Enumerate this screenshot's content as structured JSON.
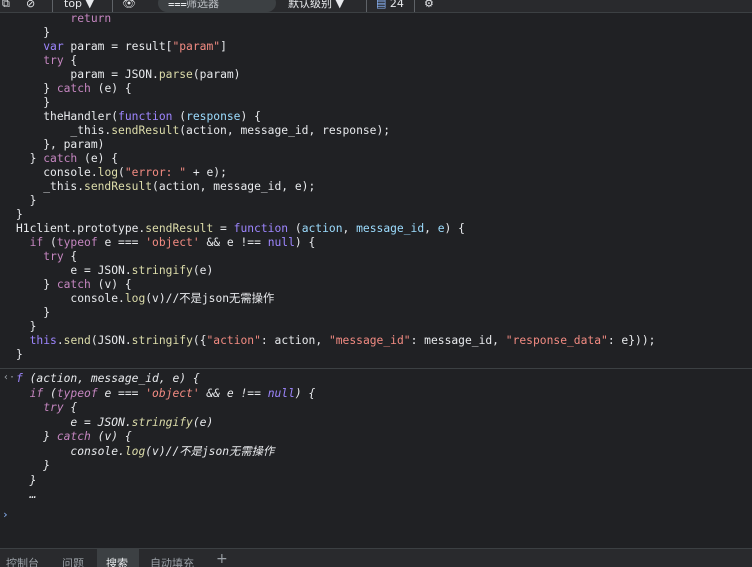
{
  "toolbar": {
    "context_label": "top",
    "filter_placeholder": "筛选器",
    "level_label": "默认级别",
    "issue_count": "24"
  },
  "code_lines": [
    [
      [
        "pad",
        "        "
      ],
      [
        "kw",
        "return"
      ]
    ],
    [
      [
        "pad",
        "    "
      ],
      [
        "prop",
        "}"
      ]
    ],
    [
      [
        "pad",
        "    "
      ],
      [
        "kw2",
        "var"
      ],
      [
        "prop",
        " param = result["
      ],
      [
        "str",
        "\"param\""
      ],
      [
        "prop",
        "]"
      ]
    ],
    [
      [
        "pad",
        "    "
      ],
      [
        "kw",
        "try"
      ],
      [
        "prop",
        " {"
      ]
    ],
    [
      [
        "pad",
        "        "
      ],
      [
        "prop",
        "param = JSON."
      ],
      [
        "fn",
        "parse"
      ],
      [
        "prop",
        "(param)"
      ]
    ],
    [
      [
        "pad",
        "    "
      ],
      [
        "prop",
        "} "
      ],
      [
        "kw",
        "catch"
      ],
      [
        "prop",
        " (e) {"
      ]
    ],
    [
      [
        "pad",
        "    "
      ],
      [
        "prop",
        "}"
      ]
    ],
    [
      [
        "pad",
        "    "
      ],
      [
        "prop",
        "theHandler("
      ],
      [
        "kw2",
        "function"
      ],
      [
        "prop",
        " ("
      ],
      [
        "num",
        "response"
      ],
      [
        "prop",
        ") {"
      ]
    ],
    [
      [
        "pad",
        "        "
      ],
      [
        "prop",
        "_this."
      ],
      [
        "fn",
        "sendResult"
      ],
      [
        "prop",
        "(action, message_id, response);"
      ]
    ],
    [
      [
        "pad",
        "    "
      ],
      [
        "prop",
        "}, param)"
      ]
    ],
    [
      [
        "pad",
        "  "
      ],
      [
        "prop",
        "} "
      ],
      [
        "kw",
        "catch"
      ],
      [
        "prop",
        " (e) {"
      ]
    ],
    [
      [
        "pad",
        "    "
      ],
      [
        "prop",
        "console."
      ],
      [
        "fn",
        "log"
      ],
      [
        "prop",
        "("
      ],
      [
        "str",
        "\"error: \""
      ],
      [
        "prop",
        " + e);"
      ]
    ],
    [
      [
        "pad",
        "    "
      ],
      [
        "prop",
        "_this."
      ],
      [
        "fn",
        "sendResult"
      ],
      [
        "prop",
        "(action, message_id, e);"
      ]
    ],
    [
      [
        "pad",
        "  "
      ],
      [
        "prop",
        "}"
      ]
    ],
    [
      [
        "pad",
        ""
      ],
      [
        "prop",
        "}"
      ]
    ],
    [
      [
        "pad",
        ""
      ],
      [
        "prop",
        "H1client.prototype."
      ],
      [
        "fn",
        "sendResult"
      ],
      [
        "prop",
        " = "
      ],
      [
        "kw2",
        "function"
      ],
      [
        "prop",
        " ("
      ],
      [
        "num",
        "action"
      ],
      [
        "prop",
        ", "
      ],
      [
        "num",
        "message_id"
      ],
      [
        "prop",
        ", "
      ],
      [
        "num",
        "e"
      ],
      [
        "prop",
        ") {"
      ]
    ],
    [
      [
        "pad",
        "  "
      ],
      [
        "kw",
        "if"
      ],
      [
        "prop",
        " ("
      ],
      [
        "kw",
        "typeof"
      ],
      [
        "prop",
        " e === "
      ],
      [
        "str",
        "'object'"
      ],
      [
        "prop",
        " && e !== "
      ],
      [
        "kw2",
        "null"
      ],
      [
        "prop",
        ") {"
      ]
    ],
    [
      [
        "pad",
        "    "
      ],
      [
        "kw",
        "try"
      ],
      [
        "prop",
        " {"
      ]
    ],
    [
      [
        "pad",
        "        "
      ],
      [
        "prop",
        "e = JSON."
      ],
      [
        "fn",
        "stringify"
      ],
      [
        "prop",
        "(e)"
      ]
    ],
    [
      [
        "pad",
        "    "
      ],
      [
        "prop",
        "} "
      ],
      [
        "kw",
        "catch"
      ],
      [
        "prop",
        " (v) {"
      ]
    ],
    [
      [
        "pad",
        "        "
      ],
      [
        "prop",
        "console."
      ],
      [
        "fn",
        "log"
      ],
      [
        "prop",
        "(v)//不是json无需操作"
      ]
    ],
    [
      [
        "pad",
        "    "
      ],
      [
        "prop",
        "}"
      ]
    ],
    [
      [
        "pad",
        "  "
      ],
      [
        "prop",
        "}"
      ]
    ],
    [
      [
        "pad",
        "  "
      ],
      [
        "kw2",
        "this"
      ],
      [
        "prop",
        "."
      ],
      [
        "fn",
        "send"
      ],
      [
        "prop",
        "(JSON."
      ],
      [
        "fn",
        "stringify"
      ],
      [
        "prop",
        "({"
      ],
      [
        "str",
        "\"action\""
      ],
      [
        "prop",
        ": action, "
      ],
      [
        "str",
        "\"message_id\""
      ],
      [
        "prop",
        ": message_id, "
      ],
      [
        "str",
        "\"response_data\""
      ],
      [
        "prop",
        ": e}));"
      ]
    ],
    [
      [
        "pad",
        ""
      ],
      [
        "prop",
        "}"
      ]
    ]
  ],
  "result_lines": [
    [
      [
        "pad",
        ""
      ],
      [
        "kw2",
        "f"
      ],
      [
        "prop",
        " (action, message_id, e) {"
      ]
    ],
    [
      [
        "pad",
        "  "
      ],
      [
        "kw",
        "if"
      ],
      [
        "prop",
        " ("
      ],
      [
        "kw",
        "typeof"
      ],
      [
        "prop",
        " e === "
      ],
      [
        "str",
        "'object'"
      ],
      [
        "prop",
        " && e !== "
      ],
      [
        "kw2",
        "null"
      ],
      [
        "prop",
        ") {"
      ]
    ],
    [
      [
        "pad",
        "    "
      ],
      [
        "kw",
        "try"
      ],
      [
        "prop",
        " {"
      ]
    ],
    [
      [
        "pad",
        "        "
      ],
      [
        "prop",
        "e = JSON."
      ],
      [
        "fn",
        "stringify"
      ],
      [
        "prop",
        "(e)"
      ]
    ],
    [
      [
        "pad",
        "    "
      ],
      [
        "prop",
        "} "
      ],
      [
        "kw",
        "catch"
      ],
      [
        "prop",
        " (v) {"
      ]
    ],
    [
      [
        "pad",
        "        "
      ],
      [
        "prop",
        "console."
      ],
      [
        "fn",
        "log"
      ],
      [
        "prop",
        "(v)//不是json无需操作"
      ]
    ],
    [
      [
        "pad",
        "    "
      ],
      [
        "prop",
        "}"
      ]
    ],
    [
      [
        "pad",
        "  "
      ],
      [
        "prop",
        "}"
      ]
    ],
    [
      [
        "pad",
        "  "
      ],
      [
        "prop",
        "…"
      ]
    ]
  ],
  "bottom_tabs": [
    "控制台",
    "问题",
    "搜索",
    "自动填充",
    "+"
  ],
  "active_tab_index": 2
}
